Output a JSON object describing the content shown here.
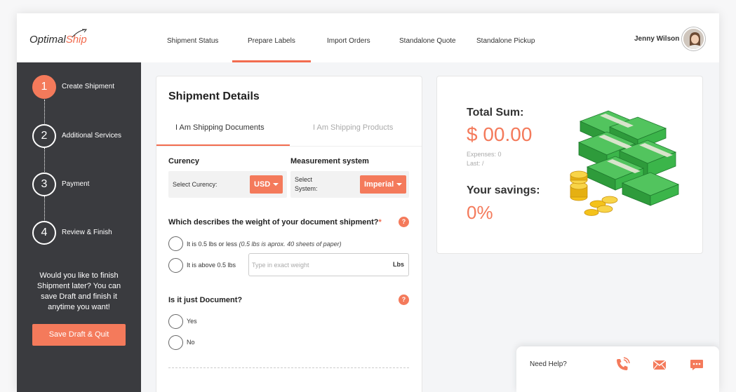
{
  "header": {
    "logo": {
      "part1": "Optimal",
      "part2": "Ship"
    },
    "nav": [
      {
        "label": "Shipment Status"
      },
      {
        "label": "Prepare Labels",
        "active": true
      },
      {
        "label": "Import Orders"
      },
      {
        "label": "Standalone Quote"
      },
      {
        "label": "Standalone Pickup"
      }
    ],
    "user": {
      "name": "Jenny Wilson"
    }
  },
  "sidebar": {
    "steps": [
      {
        "number": "1",
        "label": "Create Shipment",
        "active": true
      },
      {
        "number": "2",
        "label": "Additional Services"
      },
      {
        "number": "3",
        "label": "Payment"
      },
      {
        "number": "4",
        "label": "Review & Finish"
      }
    ],
    "draft_text": "Would you like to finish Shipment later? You can save Draft and finish it anytime you want!",
    "draft_button": "Save Draft & Quit"
  },
  "shipment": {
    "title": "Shipment Details",
    "tabs": [
      {
        "label": "I Am Shipping Documents",
        "active": true
      },
      {
        "label": "I Am Shipping Products"
      }
    ],
    "currency": {
      "label": "Curency",
      "caption": "Select Curency:",
      "value": "USD"
    },
    "measurement": {
      "label": "Measurement system",
      "caption_line1": "Select",
      "caption_line2": "System:",
      "value": "Imperial"
    },
    "weight_question": {
      "text": "Which describes the weight of your document shipment?",
      "required": "*",
      "help": "?"
    },
    "weight_options": [
      {
        "label": "It is 0.5 lbs or less",
        "note": "(0.5 lbs is aprox. 40 sheets of paper)"
      },
      {
        "label": "It is above 0.5 lbs"
      }
    ],
    "weight_input": {
      "placeholder": "Type in exact weight",
      "value": "",
      "unit": "Lbs"
    },
    "document_question": {
      "text": "Is it just Document?",
      "help": "?"
    },
    "document_options": [
      {
        "label": "Yes"
      },
      {
        "label": "No"
      }
    ]
  },
  "summary": {
    "total_label": "Total Sum:",
    "total_value": "$ 00.00",
    "expenses": "Expenses: 0",
    "last": "Last: /",
    "savings_label": "Your savings:",
    "savings_value": "0%"
  },
  "help_bar": {
    "text": "Need Help?"
  },
  "colors": {
    "accent": "#f47a5b",
    "sidebar": "#3a3b3f",
    "money": "#3bb54a",
    "coin": "#f4c21b"
  },
  "icons": [
    "phone-icon",
    "mail-icon",
    "chat-icon"
  ]
}
